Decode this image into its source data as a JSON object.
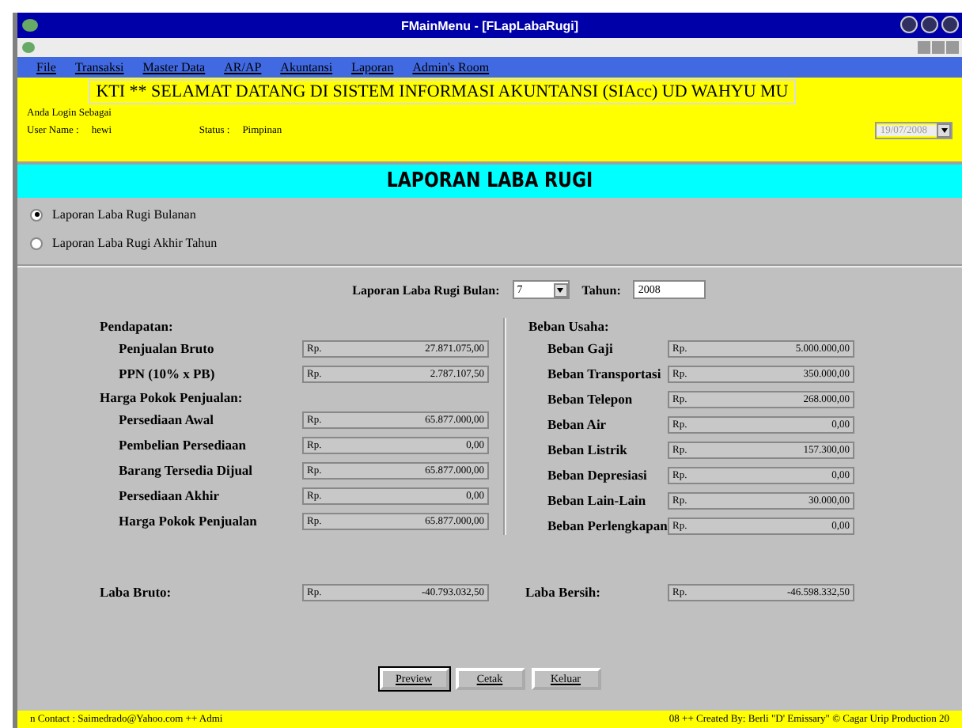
{
  "window": {
    "title": "FMainMenu - [FLapLabaRugi]"
  },
  "menu": [
    "File",
    "Transaksi",
    "Master Data",
    "AR/AP",
    "Akuntansi",
    "Laporan",
    "Admin's Room"
  ],
  "banner": "KTI ** SELAMAT DATANG DI SISTEM INFORMASI AKUNTANSI (SIAcc) UD WAHYU MU",
  "login": {
    "label": "Anda Login Sebagai",
    "user_label": "User Name :",
    "user": "hewi",
    "status_label": "Status :",
    "status": "Pimpinan",
    "date": "19/07/2008"
  },
  "page_title": "LAPORAN LABA RUGI",
  "report_types": [
    {
      "label": "Laporan Laba Rugi Bulanan",
      "selected": true
    },
    {
      "label": "Laporan Laba Rugi Akhir Tahun",
      "selected": false
    }
  ],
  "period": {
    "month_label": "Laporan Laba Rugi Bulan:",
    "month": "7",
    "year_label": "Tahun:",
    "year": "2008"
  },
  "left": [
    {
      "kind": "heading",
      "label": "Pendapatan:"
    },
    {
      "kind": "field",
      "label": "Penjualan Bruto",
      "currency": "Rp.",
      "value": "27.871.075,00"
    },
    {
      "kind": "field",
      "label": "PPN (10% x PB)",
      "currency": "Rp.",
      "value": "2.787.107,50"
    },
    {
      "kind": "heading",
      "label": "Harga Pokok Penjualan:"
    },
    {
      "kind": "field",
      "label": "Persediaan Awal",
      "currency": "Rp.",
      "value": "65.877.000,00"
    },
    {
      "kind": "field",
      "label": "Pembelian Persediaan",
      "currency": "Rp.",
      "value": "0,00"
    },
    {
      "kind": "field",
      "label": "Barang Tersedia Dijual",
      "currency": "Rp.",
      "value": "65.877.000,00"
    },
    {
      "kind": "field",
      "label": "Persediaan Akhir",
      "currency": "Rp.",
      "value": "0,00"
    },
    {
      "kind": "field",
      "label": "Harga Pokok Penjualan",
      "currency": "Rp.",
      "value": "65.877.000,00"
    }
  ],
  "right": [
    {
      "kind": "heading",
      "label": "Beban Usaha:"
    },
    {
      "kind": "field",
      "label": "Beban Gaji",
      "currency": "Rp.",
      "value": "5.000.000,00"
    },
    {
      "kind": "field",
      "label": "Beban Transportasi",
      "currency": "Rp.",
      "value": "350.000,00"
    },
    {
      "kind": "field",
      "label": "Beban Telepon",
      "currency": "Rp.",
      "value": "268.000,00"
    },
    {
      "kind": "field",
      "label": "Beban Air",
      "currency": "Rp.",
      "value": "0,00"
    },
    {
      "kind": "field",
      "label": "Beban Listrik",
      "currency": "Rp.",
      "value": "157.300,00"
    },
    {
      "kind": "field",
      "label": "Beban Depresiasi",
      "currency": "Rp.",
      "value": "0,00"
    },
    {
      "kind": "field",
      "label": "Beban Lain-Lain",
      "currency": "Rp.",
      "value": "30.000,00"
    },
    {
      "kind": "field",
      "label": "Beban Perlengkapan",
      "currency": "Rp.",
      "value": "0,00"
    }
  ],
  "gross_profit": {
    "label": "Laba Bruto:",
    "currency": "Rp.",
    "value": "-40.793.032,50"
  },
  "net_profit": {
    "label": "Laba Bersih:",
    "currency": "Rp.",
    "value": "-46.598.332,50"
  },
  "buttons": [
    {
      "label": "Preview",
      "selected": true
    },
    {
      "label": "Cetak",
      "selected": false
    },
    {
      "label": "Keluar",
      "selected": false
    }
  ],
  "status_bar": {
    "left": "n Contact : Saimedrado@Yahoo.com ++ Admi",
    "right": "08 ++ Created By: Berli \"D' Emissary\" © Cagar Urip Production 20"
  }
}
